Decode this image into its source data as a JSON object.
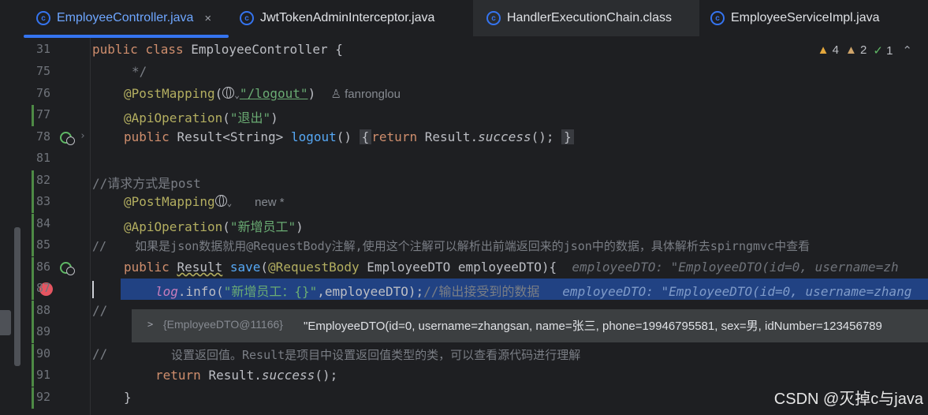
{
  "tabs": [
    {
      "label": "EmployeeController.java",
      "icon": "c",
      "close": "×"
    },
    {
      "label": "JwtTokenAdminInterceptor.java",
      "icon": "c"
    },
    {
      "label": "HandlerExecutionChain.class",
      "icon": "c"
    },
    {
      "label": "EmployeeServiceImpl.java",
      "icon": "c"
    }
  ],
  "inspections": {
    "warnings": "4",
    "weak_warnings": "2",
    "ok": "1"
  },
  "lines": {
    "l31": {
      "num": "31",
      "kw1": "public",
      "kw2": "class",
      "name": "EmployeeController {"
    },
    "l75": {
      "num": "75",
      "text": "*/"
    },
    "l76": {
      "num": "76",
      "ann": "@PostMapping",
      "str": "\"/logout\"",
      "close": ")",
      "user": "fanronglou"
    },
    "l77": {
      "num": "77",
      "ann": "@ApiOperation",
      "open": "(",
      "str": "\"退出\"",
      "close": ")"
    },
    "l78": {
      "num": "78",
      "kw": "public",
      "type": "Result<String>",
      "fn": "logout",
      "parens": "()",
      "brace_open": "{",
      "ret": "return",
      "cls": "Result.",
      "call": "success",
      "tail": "();",
      "brace_close": "}"
    },
    "l81": {
      "num": "81"
    },
    "l82": {
      "num": "82",
      "text": "//请求方式是post"
    },
    "l83": {
      "num": "83",
      "ann": "@PostMapping",
      "hint": "new *"
    },
    "l84": {
      "num": "84",
      "ann": "@ApiOperation",
      "open": "(",
      "str": "\"新增员工\"",
      "close": ")"
    },
    "l85": {
      "num": "85",
      "text": "//    如果是json数据就用@RequestBody注解,使用这个注解可以解析出前端返回来的json中的数据，具体解析去spirngmvc中查看"
    },
    "l86": {
      "num": "86",
      "kw": "public",
      "type": "Result",
      "fn": "save",
      "open": "(",
      "ann": "@RequestBody",
      "params": "EmployeeDTO employeeDTO){",
      "hint": "employeeDTO: \"EmployeeDTO(id=0, username=zh"
    },
    "l87": {
      "num": "87",
      "field": "log",
      "dot": ".info(",
      "str": "\"新增员工：{}\"",
      "rest": ",employeeDTO);",
      "comment": "//输出接受到的数据",
      "hint": "employeeDTO: \"EmployeeDTO(id=0, username=zhang"
    },
    "l88": {
      "num": "88",
      "text": "//"
    },
    "l89": {
      "num": "89"
    },
    "l90": {
      "num": "90",
      "prefix": "//",
      "text": "设置返回值。Result是项目中设置返回值类型的类，可以查看源代码进行理解"
    },
    "l91": {
      "num": "91",
      "ret": "return",
      "cls": "Result.",
      "call": "success",
      "tail": "();"
    },
    "l92": {
      "num": "92",
      "text": "}"
    }
  },
  "debug_popup": {
    "expand": ">",
    "ref": "{EmployeeDTO@11166}",
    "value": "\"EmployeeDTO(id=0, username=zhangsan, name=张三, phone=19946795581, sex=男, idNumber=123456789"
  },
  "watermark": "CSDN @灭掉c与java"
}
